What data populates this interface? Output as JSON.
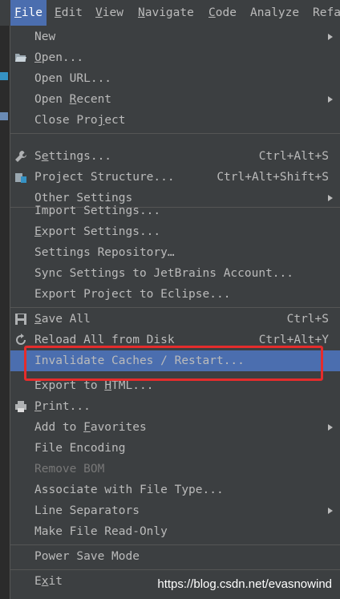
{
  "menubar": [
    {
      "label": "File",
      "ul": 0
    },
    {
      "label": "Edit",
      "ul": 0
    },
    {
      "label": "View",
      "ul": 0
    },
    {
      "label": "Navigate",
      "ul": 0
    },
    {
      "label": "Code",
      "ul": 0
    },
    {
      "label": "Analyze",
      "ul": -1
    },
    {
      "label": "Refa",
      "ul": -1
    }
  ],
  "menu": [
    {
      "label": "New",
      "submenu": true
    },
    {
      "label": "Open...",
      "ul": 0,
      "icon": "folder-open-icon"
    },
    {
      "label": "Open URL..."
    },
    {
      "label": "Open Recent",
      "ul": 5,
      "submenu": true
    },
    {
      "label": "Close Project",
      "ul": 9
    },
    {
      "sep": true
    },
    {
      "label": "Settings...",
      "ul": 1,
      "shortcut": "Ctrl+Alt+S",
      "icon": "wrench-icon"
    },
    {
      "label": "Project Structure...",
      "shortcut": "Ctrl+Alt+Shift+S",
      "icon": "project-structure-icon"
    },
    {
      "label": "Other Settings",
      "submenu": true
    },
    {
      "sep": true
    },
    {
      "label": "Import Settings..."
    },
    {
      "label": "Export Settings...",
      "ul": 0
    },
    {
      "label": "Settings Repository…"
    },
    {
      "label": "Sync Settings to JetBrains Account..."
    },
    {
      "label": "Export Project to Eclipse..."
    },
    {
      "sep": true
    },
    {
      "label": "Save All",
      "ul": 0,
      "shortcut": "Ctrl+S",
      "icon": "save-icon"
    },
    {
      "label": "Reload All from Disk",
      "shortcut": "Ctrl+Alt+Y",
      "icon": "reload-icon"
    },
    {
      "label": "Invalidate Caches / Restart...",
      "selected": true
    },
    {
      "label": "Export to HTML...",
      "ul": 10
    },
    {
      "label": "Print...",
      "ul": 0,
      "icon": "print-icon"
    },
    {
      "label": "Add to Favorites",
      "ul": 7,
      "submenu": true
    },
    {
      "label": "File Encoding"
    },
    {
      "label": "Remove BOM",
      "disabled": true
    },
    {
      "label": "Associate with File Type..."
    },
    {
      "label": "Line Separators",
      "submenu": true
    },
    {
      "label": "Make File Read-Only"
    },
    {
      "sep": true
    },
    {
      "label": "Power Save Mode"
    },
    {
      "sep": true
    },
    {
      "label": "Exit",
      "ul": 1
    }
  ],
  "watermark": "https://blog.csdn.net/evasnowind",
  "colors": {
    "background": "#3c3f41",
    "selection": "#4b6eaf",
    "text": "#bbbbbb",
    "disabled": "#777777",
    "highlight_box": "#e52c2c"
  }
}
